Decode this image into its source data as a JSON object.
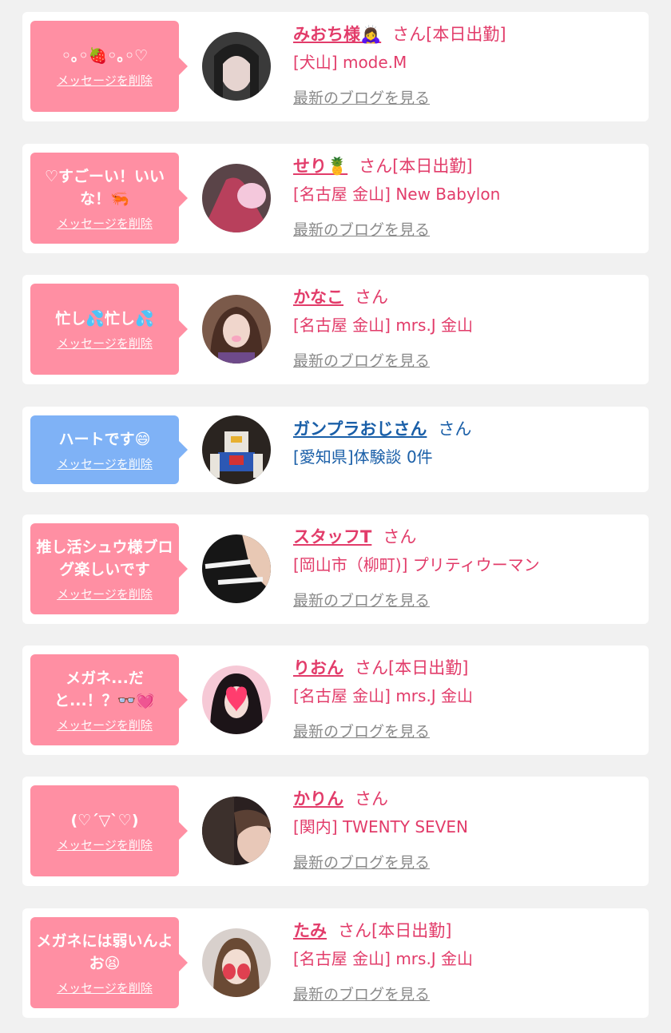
{
  "cards": [
    {
      "message": "◦｡◦🍓◦｡◦♡",
      "delete_label": "メッセージを削除",
      "name": "みおち様🙇‍♀️",
      "suffix": "さん[本日出勤]",
      "location": "[犬山] mode.M",
      "blog_link": "最新のブログを見る"
    },
    {
      "message": "♡すごーい！いいな！🦐",
      "delete_label": "メッセージを削除",
      "name": "せり🍍",
      "suffix": "さん[本日出勤]",
      "location": "[名古屋 金山] New Babylon",
      "blog_link": "最新のブログを見る"
    },
    {
      "message": "忙し💦忙し💦",
      "delete_label": "メッセージを削除",
      "name": "かなこ",
      "suffix": "さん",
      "location": "[名古屋 金山] mrs.J 金山",
      "blog_link": "最新のブログを見る"
    },
    {
      "message": "ハートです😄",
      "delete_label": "メッセージを削除",
      "name": "ガンプラおじさん",
      "suffix": "さん",
      "location": "[愛知県]体験談 0件"
    },
    {
      "message": "推し活シュウ様ブログ楽しいです",
      "delete_label": "メッセージを削除",
      "name": "スタッフT",
      "suffix": "さん",
      "location": "[岡山市（柳町)] プリティウーマン",
      "blog_link": "最新のブログを見る"
    },
    {
      "message": "メガネ...だと...！？👓💓",
      "delete_label": "メッセージを削除",
      "name": "りおん",
      "suffix": "さん[本日出勤]",
      "location": "[名古屋 金山] mrs.J 金山",
      "blog_link": "最新のブログを見る"
    },
    {
      "message": "(♡´▽`♡)",
      "delete_label": "メッセージを削除",
      "name": "かりん",
      "suffix": "さん",
      "location": "[関内] TWENTY SEVEN",
      "blog_link": "最新のブログを見る"
    },
    {
      "message": "メガネには弱いんよお😫",
      "delete_label": "メッセージを削除",
      "name": "たみ",
      "suffix": "さん[本日出勤]",
      "location": "[名古屋 金山] mrs.J 金山",
      "blog_link": "最新のブログを見る"
    }
  ],
  "colors": {
    "pink_bubble": "#ff8fa3",
    "blue_bubble": "#7fb2f6",
    "pink_text": "#e23c6a",
    "blue_text": "#1a5fa8",
    "link_gray": "#8a8a8a"
  }
}
